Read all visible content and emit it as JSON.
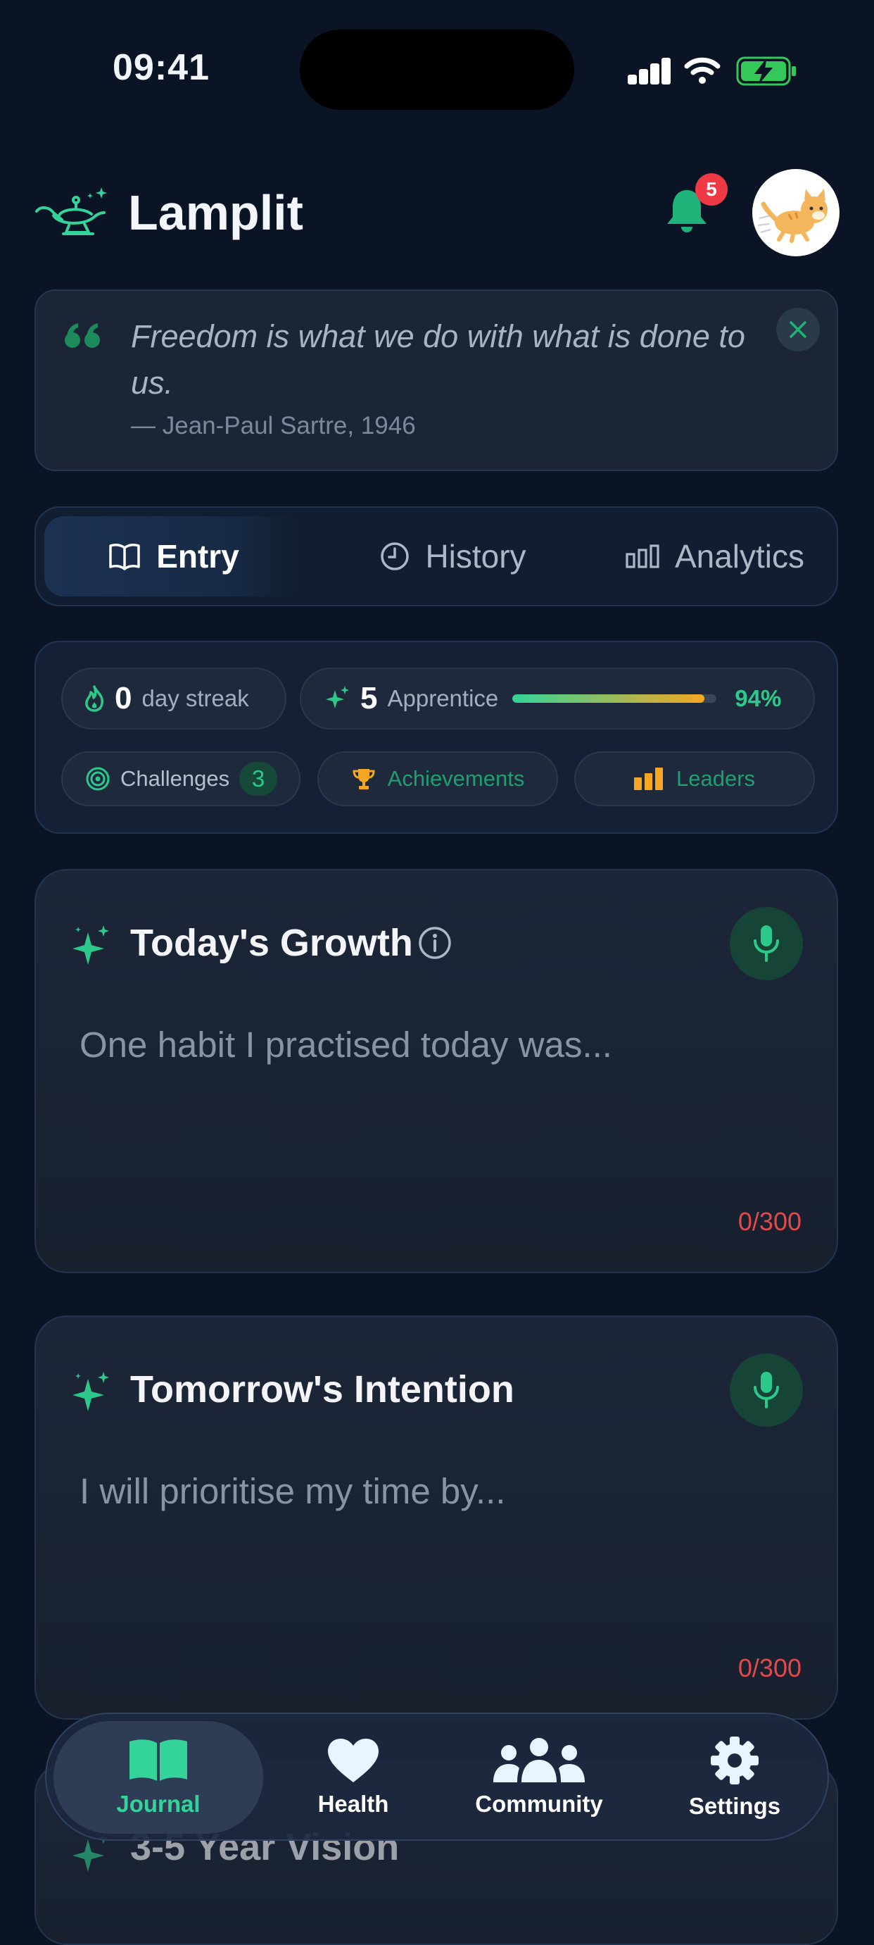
{
  "status_bar": {
    "time": "09:41"
  },
  "header": {
    "title": "Lamplit",
    "notification_count": "5"
  },
  "quote": {
    "text": "Freedom is what we do with what is done to us.",
    "author": "— Jean-Paul Sartre, 1946"
  },
  "tabs": [
    {
      "label": "Entry",
      "icon": "book-icon",
      "active": true
    },
    {
      "label": "History",
      "icon": "clock-icon",
      "active": false
    },
    {
      "label": "Analytics",
      "icon": "bar-chart-icon",
      "active": false
    }
  ],
  "stats": {
    "streak_value": "0",
    "streak_label": "day streak",
    "level_value": "5",
    "level_label": "Apprentice",
    "level_progress": 0.94,
    "level_percent": "94%",
    "challenges_label": "Challenges",
    "challenges_count": "3",
    "achievements_label": "Achievements",
    "leaders_label": "Leaders"
  },
  "cards": {
    "growth": {
      "title": "Today's Growth",
      "placeholder": "One habit I practised today was...",
      "count": "0/300"
    },
    "intention": {
      "title": "Tomorrow's Intention",
      "placeholder": "I will prioritise my time by...",
      "count": "0/300"
    },
    "vision": {
      "title": "3-5 Year Vision"
    }
  },
  "nav": {
    "items": [
      {
        "label": "Journal",
        "icon": "book-open-icon",
        "active": true
      },
      {
        "label": "Health",
        "icon": "heart-icon",
        "active": false
      },
      {
        "label": "Community",
        "icon": "users-icon",
        "active": false
      },
      {
        "label": "Settings",
        "icon": "gear-icon",
        "active": false
      }
    ]
  },
  "colors": {
    "background": "#0b1424",
    "accent_green": "#34d399",
    "badge_red": "#ef3a45",
    "progress_orange": "#f5a623",
    "counter_red": "#e24a4a"
  }
}
